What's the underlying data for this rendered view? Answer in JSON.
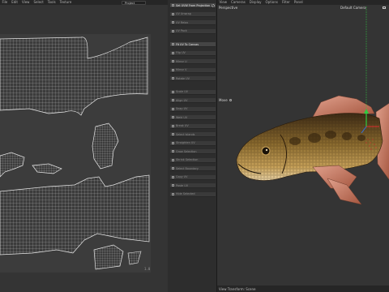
{
  "uv_editor": {
    "menu": [
      "File",
      "Edit",
      "View",
      "Select",
      "Tools",
      "Texture"
    ],
    "mode_combo": "Project",
    "tick_right": "1.0"
  },
  "commands": {
    "items": [
      {
        "label": "Set UVW From Projection",
        "active": true
      },
      {
        "label": "UV Unwrap",
        "active": false
      },
      {
        "label": "UV Relax",
        "active": false
      },
      {
        "label": "UV Pack",
        "active": false
      },
      {
        "label": "Fit UV To Canvas",
        "active": true
      },
      {
        "label": "Flip UV",
        "active": false
      },
      {
        "label": "Mirror U",
        "active": false
      },
      {
        "label": "Mirror V",
        "active": false
      },
      {
        "label": "Rotate UV",
        "active": false
      },
      {
        "label": "Scale UV",
        "active": false
      },
      {
        "label": "Align UV",
        "active": false
      },
      {
        "label": "Snap UV",
        "active": false
      },
      {
        "label": "Weld UV",
        "active": false
      },
      {
        "label": "Break UV",
        "active": false
      },
      {
        "label": "Select Islands",
        "active": false
      },
      {
        "label": "Straighten UV",
        "active": false
      },
      {
        "label": "Grow Selection",
        "active": false
      },
      {
        "label": "Shrink Selection",
        "active": false
      },
      {
        "label": "Select Boundary",
        "active": false
      },
      {
        "label": "Copy UV",
        "active": false
      },
      {
        "label": "Paste UV",
        "active": false
      },
      {
        "label": "Hide Selected",
        "active": false
      }
    ]
  },
  "viewport": {
    "menu": [
      "View",
      "Cameras",
      "Display",
      "Options",
      "Filter",
      "Panel"
    ],
    "view_name": "Perspective",
    "camera": "Default Camera",
    "move_label": "Move",
    "status": "View Transform: Scene"
  },
  "colors": {
    "fish_dark": "#3c2a15",
    "fish_mid": "#8a6a2e",
    "fish_light": "#c9a35a",
    "fin": "#c0705f",
    "uv_lines": "#cfcfcf",
    "axis_green": "#2ecc40"
  }
}
